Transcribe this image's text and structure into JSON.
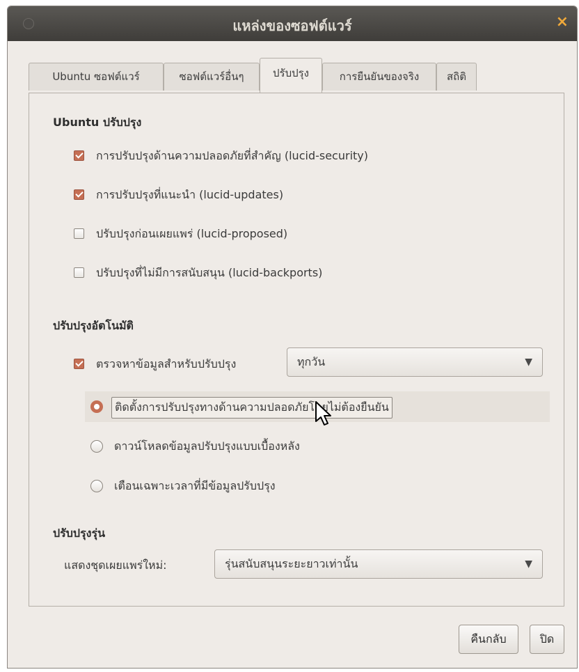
{
  "window": {
    "title": "แหล่งของซอฟต์แวร์",
    "close_glyph": "×"
  },
  "tabs": [
    {
      "label": "Ubuntu ซอฟต์แวร์"
    },
    {
      "label": "ซอฟต์แวร์อื่นๆ"
    },
    {
      "label": "ปรับปรุง"
    },
    {
      "label": "การยืนยันของจริง"
    },
    {
      "label": "สถิติ"
    }
  ],
  "ubuntu_updates": {
    "heading": "Ubuntu ปรับปรุง",
    "items": [
      {
        "label": "การปรับปรุงด้านความปลอดภัยที่สำคัญ (lucid-security)",
        "checked": true
      },
      {
        "label": "การปรับปรุงที่แนะนำ (lucid-updates)",
        "checked": true
      },
      {
        "label": "ปรับปรุงก่อนเผยแพร่ (lucid-proposed)",
        "checked": false
      },
      {
        "label": "ปรับปรุงที่ไม่มีการสนับสนุน (lucid-backports)",
        "checked": false
      }
    ]
  },
  "auto_updates": {
    "heading": "ปรับปรุงอัตโนมัติ",
    "check_label": "ตรวจหาข้อมูลสำหรับปรับปรุง",
    "check_checked": true,
    "frequency": "ทุกวัน",
    "options": [
      {
        "label": "ติดตั้งการปรับปรุงทางด้านความปลอดภัยโดยไม่ต้องยืนยัน",
        "selected": true
      },
      {
        "label": "ดาวน์โหลดข้อมูลปรับปรุงแบบเบื้องหลัง",
        "selected": false
      },
      {
        "label": "เตือนเฉพาะเวลาที่มีข้อมูลปรับปรุง",
        "selected": false
      }
    ]
  },
  "release_upgrade": {
    "heading": "ปรับปรุงรุ่น",
    "label": "แสดงชุดเผยแพร่ใหม่:",
    "value": "รุ่นสนับสนุนระยะยาวเท่านั้น"
  },
  "buttons": {
    "revert": "คืนกลับ",
    "close": "ปิด"
  },
  "colors": {
    "accent": "#c56f54",
    "titlebar": "#3f3d3a",
    "window_bg": "#efebe7"
  }
}
